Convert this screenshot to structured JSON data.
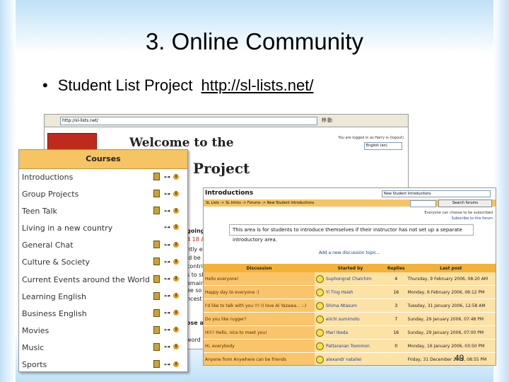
{
  "slide": {
    "title": "3. Online Community",
    "bullet": "Student List Project",
    "link": "http://sl-lists.net/",
    "page_number": "49"
  },
  "browser": {
    "address": "http://sl-lists.net/",
    "go_label": "移動",
    "logged_in": "You are logged in as Harry is (logout)",
    "language": "English (en)",
    "welcome_line1": "Welcome to the",
    "welcome_line2": "Project",
    "fragments": [
      "going",
      "4 18 A",
      "ntly er",
      "ld be",
      "contri",
      "s to sh",
      "emain",
      "ee so",
      "ncest!",
      "ose a",
      "word"
    ]
  },
  "courses": {
    "header": "Courses",
    "items": [
      "Introductions",
      "Group Projects",
      "Teen Talk",
      "Living in a new country",
      "General Chat",
      "Culture & Society",
      "Current Events around the World",
      "Learning English",
      "Business English",
      "Movies",
      "Music",
      "Sports"
    ]
  },
  "introductions": {
    "title": "Introductions",
    "breadcrumb": "SL Lists -> SL Intros -> Forums -> New Student Introductions",
    "jump_to": "New Student Introductions",
    "search_button": "Search forums",
    "subscribe": "Everyone can choose to be subscribed",
    "subscribe2": "Subscribe to this forum",
    "description": "This area is for students to introduce themselves if their instructor has not set up a separate introductory area.",
    "add_new": "Add a new discussion topic...",
    "columns": [
      "Discussion",
      "Started by",
      "Replies",
      "Last post"
    ],
    "rows": [
      {
        "discussion": "Hello everyone!",
        "started_by": "Suphongrat Chaichim",
        "replies": "4",
        "last_post": "Thursday, 9 February 2006, 08:20 AM"
      },
      {
        "discussion": "Happy day to everyone :)",
        "started_by": "Yi Ting Hsieh",
        "replies": "16",
        "last_post": "Monday, 6 February 2006, 06:12 PM"
      },
      {
        "discussion": "I'd like to talk with you !!! (I love Al Yazawa... :-)",
        "started_by": "Shima Ntasum",
        "replies": "3",
        "last_post": "Tuesday, 31 January 2006, 12:58 AM"
      },
      {
        "discussion": "Do you like rugger?",
        "started_by": "eiichi sumimoto",
        "replies": "7",
        "last_post": "Sunday, 29 January 2006, 07:48 PM"
      },
      {
        "discussion": "Hi!!! Hello, nice to meet you!",
        "started_by": "Mari Ikeda",
        "replies": "16",
        "last_post": "Sunday, 29 January 2006, 07:00 PM"
      },
      {
        "discussion": "Hi, everybody",
        "started_by": "Pattaranan Toonmon",
        "replies": "0",
        "last_post": "Monday, 16 January 2006, 03:50 PM"
      },
      {
        "discussion": "Anyone from Anywhere can be friends",
        "started_by": "alexandr nataliei",
        "replies": "",
        "last_post": "Friday, 31 December 2005, 08:55 PM"
      }
    ]
  },
  "colors": {
    "accent": "#f6c462",
    "row_dark": "#f9c46a",
    "row_light": "#fde2a6",
    "logo_red": "#c02a1e",
    "link_blue": "#1a3fa0"
  }
}
